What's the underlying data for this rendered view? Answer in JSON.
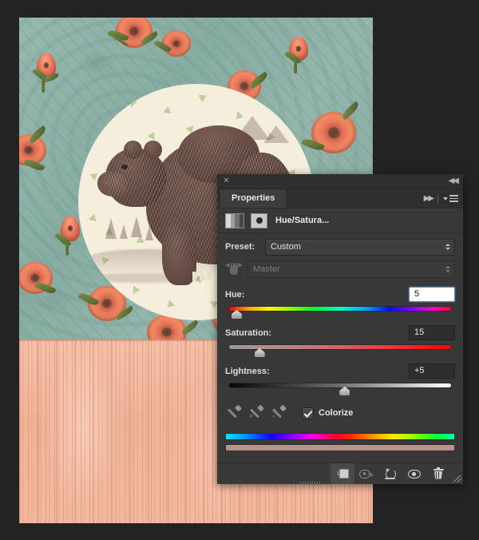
{
  "app": {
    "background_color": "#232323"
  },
  "document": {
    "name": "bear-collage-canvas",
    "description": "Vintage bear illustration in a cream circle over teal floral wallpaper above a peach wood-grain panel",
    "wallpaper_color": "#8db3a9",
    "flower_color": "#ee7f60",
    "medallion_color": "#f6eedc",
    "confetti_color": "#b9c791",
    "wood_color": "#f0b79e",
    "bear_color": "#6a5048"
  },
  "panel": {
    "close_label": "×",
    "collapse_label": "◀◀",
    "expand_label": "▶▶",
    "tab_label": "Properties",
    "menu_label": "≡",
    "adjustment": {
      "title": "Hue/Satura...",
      "icon_name": "hue-saturation-icon",
      "mask_name": "layer-mask-thumbnail"
    },
    "preset": {
      "label": "Preset:",
      "value": "Custom"
    },
    "channel": {
      "value": "Master",
      "disabled": true,
      "targeted_adjust_tool": "on-image-adjustment-tool"
    },
    "sliders": [
      {
        "name": "hue",
        "label": "Hue:",
        "value": "5",
        "numeric": 5,
        "min": -180,
        "max": 180,
        "thumb_percent": 5,
        "focused": true
      },
      {
        "name": "saturation",
        "label": "Saturation:",
        "value": "15",
        "numeric": 15,
        "min": 0,
        "max": 100,
        "thumb_percent": 15,
        "focused": false
      },
      {
        "name": "lightness",
        "label": "Lightness:",
        "value": "+5",
        "numeric": 5,
        "min": -100,
        "max": 100,
        "thumb_percent": 52,
        "focused": false
      }
    ],
    "eyedroppers": [
      {
        "name": "sample-eyedropper",
        "sign": ""
      },
      {
        "name": "add-to-sample-eyedropper",
        "sign": "+"
      },
      {
        "name": "subtract-from-sample-eyedropper",
        "sign": "−"
      }
    ],
    "colorize": {
      "label": "Colorize",
      "checked": true
    },
    "ramps": {
      "spectrum_name": "input-spectrum-ramp",
      "result_name": "output-color-ramp",
      "result_color": "#b9938e"
    },
    "footer_buttons": [
      {
        "name": "clip-to-layer-button",
        "label": "Clip to layer",
        "selected": true
      },
      {
        "name": "view-previous-state-button",
        "label": "View previous state",
        "selected": false
      },
      {
        "name": "reset-button",
        "label": "Reset to adjustment defaults",
        "selected": false
      },
      {
        "name": "toggle-visibility-button",
        "label": "Toggle layer visibility",
        "selected": false
      },
      {
        "name": "delete-button",
        "label": "Delete adjustment layer",
        "selected": false
      }
    ]
  }
}
